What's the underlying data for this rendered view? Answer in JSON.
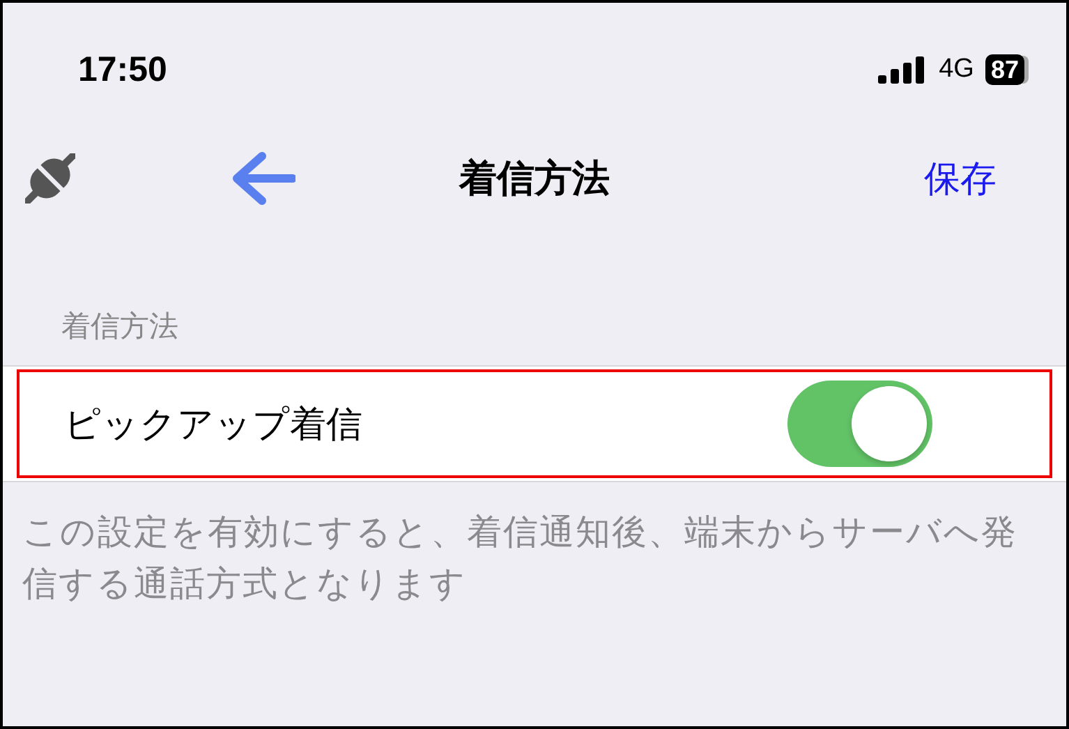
{
  "status_bar": {
    "time": "17:50",
    "network": "4G",
    "battery": "87"
  },
  "nav_bar": {
    "title": "着信方法",
    "save": "保存"
  },
  "section": {
    "header": "着信方法",
    "rows": [
      {
        "label": "ピックアップ着信",
        "on": true,
        "highlighted": true
      }
    ],
    "footer": "この設定を有効にすると、着信通知後、端末からサーバへ発信する通話方式となります"
  }
}
